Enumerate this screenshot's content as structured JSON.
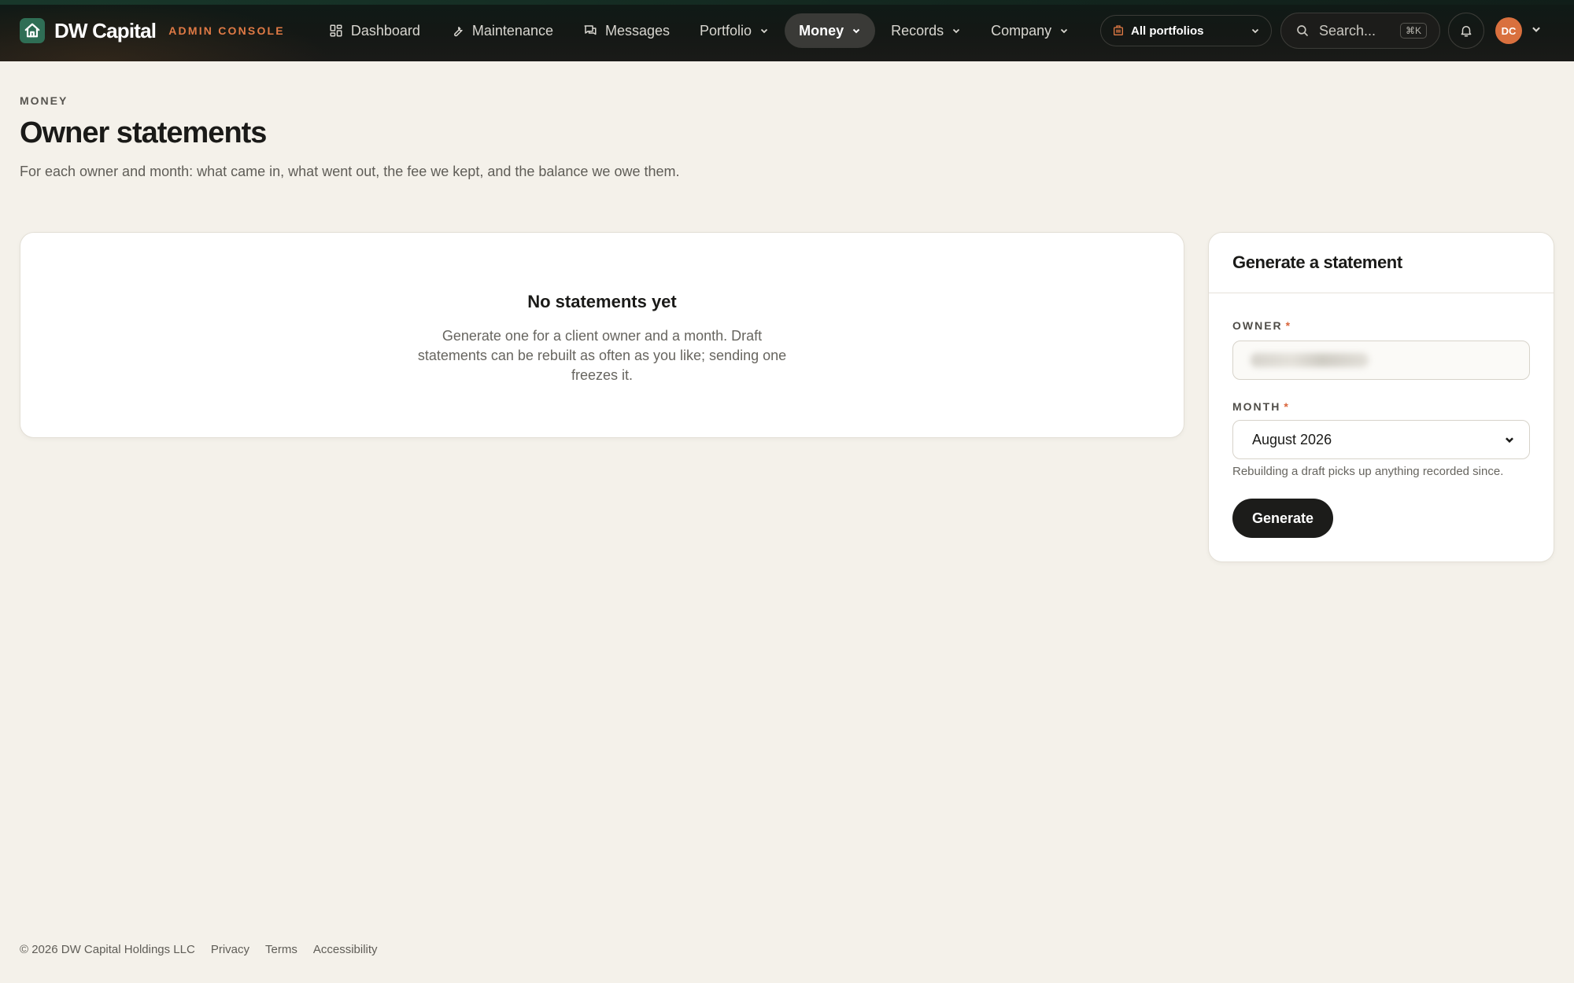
{
  "brand": {
    "name": "DW Capital",
    "tag": "ADMIN CONSOLE",
    "logo_icon": "house-icon",
    "logo_color": "#2f6e55",
    "tag_color": "#e07a45"
  },
  "nav": {
    "items": [
      {
        "label": "Dashboard",
        "icon": "grid-icon"
      },
      {
        "label": "Maintenance",
        "icon": "wrench-icon"
      },
      {
        "label": "Messages",
        "icon": "chat-icon"
      },
      {
        "label": "Portfolio",
        "has_dropdown": true
      },
      {
        "label": "Money",
        "has_dropdown": true,
        "active": true
      },
      {
        "label": "Records",
        "has_dropdown": true
      },
      {
        "label": "Company",
        "has_dropdown": true
      }
    ],
    "portfolio_filter": "All portfolios",
    "search_placeholder": "Search...",
    "search_shortcut": "⌘K",
    "avatar_initials": "DC",
    "avatar_color": "#d9703e"
  },
  "header": {
    "eyebrow": "MONEY",
    "title": "Owner statements",
    "subtitle": "For each owner and month: what came in, what went out, the fee we kept, and the balance we owe them."
  },
  "empty_state": {
    "title": "No statements yet",
    "text": "Generate one for a client owner and a month. Draft statements can be rebuilt as often as you like; sending one freezes it."
  },
  "generate_form": {
    "title": "Generate a statement",
    "owner_label": "OWNER",
    "required_mark": "*",
    "month_label": "MONTH",
    "month_value": "August 2026",
    "month_hint": "Rebuilding a draft picks up anything recorded since.",
    "submit_label": "Generate"
  },
  "footer": {
    "copyright": "© 2026 DW Capital Holdings LLC",
    "links": [
      "Privacy",
      "Terms",
      "Accessibility"
    ]
  }
}
